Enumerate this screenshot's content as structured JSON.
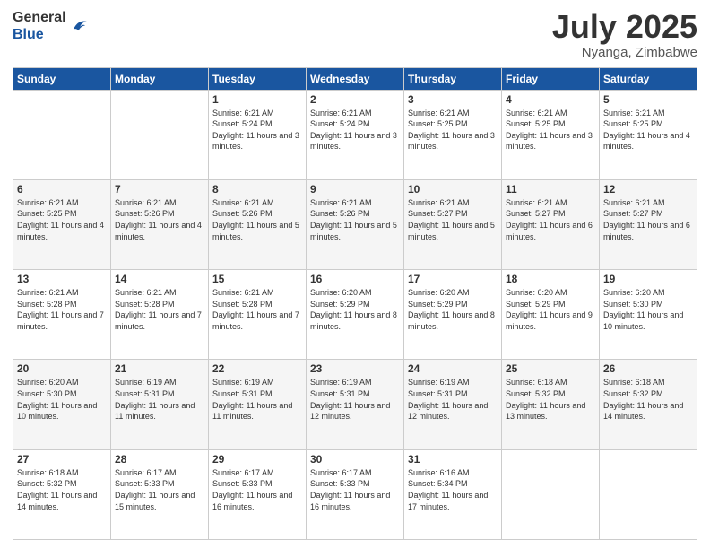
{
  "header": {
    "logo_general": "General",
    "logo_blue": "Blue",
    "month": "July 2025",
    "location": "Nyanga, Zimbabwe"
  },
  "days_of_week": [
    "Sunday",
    "Monday",
    "Tuesday",
    "Wednesday",
    "Thursday",
    "Friday",
    "Saturday"
  ],
  "weeks": [
    [
      {
        "day": "",
        "info": ""
      },
      {
        "day": "",
        "info": ""
      },
      {
        "day": "1",
        "info": "Sunrise: 6:21 AM\nSunset: 5:24 PM\nDaylight: 11 hours and 3 minutes."
      },
      {
        "day": "2",
        "info": "Sunrise: 6:21 AM\nSunset: 5:24 PM\nDaylight: 11 hours and 3 minutes."
      },
      {
        "day": "3",
        "info": "Sunrise: 6:21 AM\nSunset: 5:25 PM\nDaylight: 11 hours and 3 minutes."
      },
      {
        "day": "4",
        "info": "Sunrise: 6:21 AM\nSunset: 5:25 PM\nDaylight: 11 hours and 3 minutes."
      },
      {
        "day": "5",
        "info": "Sunrise: 6:21 AM\nSunset: 5:25 PM\nDaylight: 11 hours and 4 minutes."
      }
    ],
    [
      {
        "day": "6",
        "info": "Sunrise: 6:21 AM\nSunset: 5:25 PM\nDaylight: 11 hours and 4 minutes."
      },
      {
        "day": "7",
        "info": "Sunrise: 6:21 AM\nSunset: 5:26 PM\nDaylight: 11 hours and 4 minutes."
      },
      {
        "day": "8",
        "info": "Sunrise: 6:21 AM\nSunset: 5:26 PM\nDaylight: 11 hours and 5 minutes."
      },
      {
        "day": "9",
        "info": "Sunrise: 6:21 AM\nSunset: 5:26 PM\nDaylight: 11 hours and 5 minutes."
      },
      {
        "day": "10",
        "info": "Sunrise: 6:21 AM\nSunset: 5:27 PM\nDaylight: 11 hours and 5 minutes."
      },
      {
        "day": "11",
        "info": "Sunrise: 6:21 AM\nSunset: 5:27 PM\nDaylight: 11 hours and 6 minutes."
      },
      {
        "day": "12",
        "info": "Sunrise: 6:21 AM\nSunset: 5:27 PM\nDaylight: 11 hours and 6 minutes."
      }
    ],
    [
      {
        "day": "13",
        "info": "Sunrise: 6:21 AM\nSunset: 5:28 PM\nDaylight: 11 hours and 7 minutes."
      },
      {
        "day": "14",
        "info": "Sunrise: 6:21 AM\nSunset: 5:28 PM\nDaylight: 11 hours and 7 minutes."
      },
      {
        "day": "15",
        "info": "Sunrise: 6:21 AM\nSunset: 5:28 PM\nDaylight: 11 hours and 7 minutes."
      },
      {
        "day": "16",
        "info": "Sunrise: 6:20 AM\nSunset: 5:29 PM\nDaylight: 11 hours and 8 minutes."
      },
      {
        "day": "17",
        "info": "Sunrise: 6:20 AM\nSunset: 5:29 PM\nDaylight: 11 hours and 8 minutes."
      },
      {
        "day": "18",
        "info": "Sunrise: 6:20 AM\nSunset: 5:29 PM\nDaylight: 11 hours and 9 minutes."
      },
      {
        "day": "19",
        "info": "Sunrise: 6:20 AM\nSunset: 5:30 PM\nDaylight: 11 hours and 10 minutes."
      }
    ],
    [
      {
        "day": "20",
        "info": "Sunrise: 6:20 AM\nSunset: 5:30 PM\nDaylight: 11 hours and 10 minutes."
      },
      {
        "day": "21",
        "info": "Sunrise: 6:19 AM\nSunset: 5:31 PM\nDaylight: 11 hours and 11 minutes."
      },
      {
        "day": "22",
        "info": "Sunrise: 6:19 AM\nSunset: 5:31 PM\nDaylight: 11 hours and 11 minutes."
      },
      {
        "day": "23",
        "info": "Sunrise: 6:19 AM\nSunset: 5:31 PM\nDaylight: 11 hours and 12 minutes."
      },
      {
        "day": "24",
        "info": "Sunrise: 6:19 AM\nSunset: 5:31 PM\nDaylight: 11 hours and 12 minutes."
      },
      {
        "day": "25",
        "info": "Sunrise: 6:18 AM\nSunset: 5:32 PM\nDaylight: 11 hours and 13 minutes."
      },
      {
        "day": "26",
        "info": "Sunrise: 6:18 AM\nSunset: 5:32 PM\nDaylight: 11 hours and 14 minutes."
      }
    ],
    [
      {
        "day": "27",
        "info": "Sunrise: 6:18 AM\nSunset: 5:32 PM\nDaylight: 11 hours and 14 minutes."
      },
      {
        "day": "28",
        "info": "Sunrise: 6:17 AM\nSunset: 5:33 PM\nDaylight: 11 hours and 15 minutes."
      },
      {
        "day": "29",
        "info": "Sunrise: 6:17 AM\nSunset: 5:33 PM\nDaylight: 11 hours and 16 minutes."
      },
      {
        "day": "30",
        "info": "Sunrise: 6:17 AM\nSunset: 5:33 PM\nDaylight: 11 hours and 16 minutes."
      },
      {
        "day": "31",
        "info": "Sunrise: 6:16 AM\nSunset: 5:34 PM\nDaylight: 11 hours and 17 minutes."
      },
      {
        "day": "",
        "info": ""
      },
      {
        "day": "",
        "info": ""
      }
    ]
  ]
}
